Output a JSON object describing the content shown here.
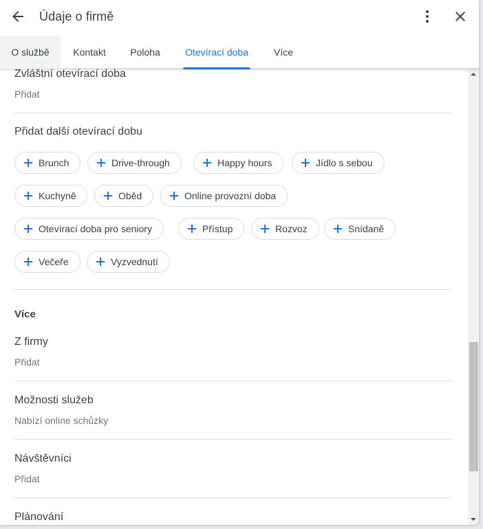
{
  "header": {
    "title": "Údaje o firmě",
    "back_icon": "arrow-back-icon",
    "more_icon": "more-vert-icon",
    "close_icon": "close-icon"
  },
  "tabs": [
    {
      "label": "O službě"
    },
    {
      "label": "Kontakt"
    },
    {
      "label": "Poloha"
    },
    {
      "label": "Otevírací doba",
      "active": true
    },
    {
      "label": "Více"
    }
  ],
  "special_hours": {
    "title": "Zvláštní otevírací doba",
    "action": "Přidat"
  },
  "more_hours": {
    "title": "Přidat další otevírací dobu",
    "chips": [
      "Brunch",
      "Drive-through",
      "Happy hours",
      "Jídlo s sebou",
      "Kuchyně",
      "Oběd",
      "Online provozní doba",
      "Otevírací doba pro seniory",
      "Přístup",
      "Rozvoz",
      "Snídaně",
      "Večeře",
      "Vyzvednutí"
    ]
  },
  "more_section": {
    "heading": "Více",
    "rows": [
      {
        "title": "Z firmy",
        "value": "Přidat"
      },
      {
        "title": "Možnosti služeb",
        "value": "Nabízí online schůzky"
      },
      {
        "title": "Návštěvníci",
        "value": "Přidat"
      },
      {
        "title": "Plánování",
        "value": ""
      }
    ]
  },
  "colors": {
    "accent": "#1a73e8",
    "text": "#3c4043",
    "secondary": "#70757a",
    "divider": "#e0e0e0"
  }
}
